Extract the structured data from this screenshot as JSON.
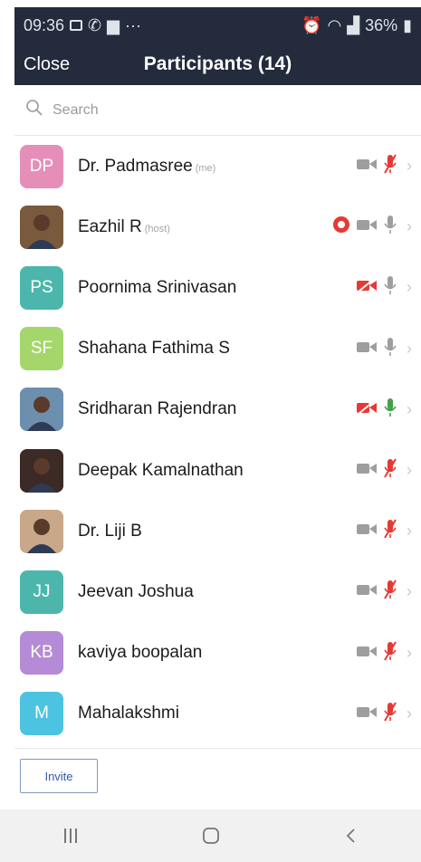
{
  "status_bar": {
    "time": "09:36",
    "battery": "36%",
    "left_icons": [
      "gallery-icon",
      "whatsapp-icon",
      "message-icon",
      "more-dots-icon"
    ],
    "right_icons": [
      "alarm-icon",
      "wifi-icon",
      "signal-icon",
      "battery-icon"
    ]
  },
  "header": {
    "close_label": "Close",
    "title": "Participants (14)"
  },
  "search": {
    "placeholder": "Search"
  },
  "participants": [
    {
      "name": "Dr. Padmasree",
      "tag": "(me)",
      "initials": "DP",
      "avatar_color": "#e58fb8",
      "photo": false,
      "recording": false,
      "video": "off",
      "mic": "muted"
    },
    {
      "name": "Eazhil R",
      "tag": "(host)",
      "initials": "",
      "avatar_color": "#7a5a3c",
      "photo": true,
      "recording": true,
      "video": "off",
      "mic": "on"
    },
    {
      "name": "Poornima Srinivasan",
      "tag": "",
      "initials": "PS",
      "avatar_color": "#4db6ac",
      "photo": false,
      "recording": false,
      "video": "muted",
      "mic": "on"
    },
    {
      "name": "Shahana Fathima S",
      "tag": "",
      "initials": "SF",
      "avatar_color": "#a5d66b",
      "photo": false,
      "recording": false,
      "video": "off",
      "mic": "on"
    },
    {
      "name": "Sridharan Rajendran",
      "tag": "",
      "initials": "",
      "avatar_color": "#6d8fae",
      "photo": true,
      "recording": false,
      "video": "muted",
      "mic": "active"
    },
    {
      "name": "Deepak Kamalnathan",
      "tag": "",
      "initials": "",
      "avatar_color": "#3b2a25",
      "photo": true,
      "recording": false,
      "video": "off",
      "mic": "muted"
    },
    {
      "name": "Dr. Liji B",
      "tag": "",
      "initials": "",
      "avatar_color": "#c9a88a",
      "photo": true,
      "recording": false,
      "video": "off",
      "mic": "muted"
    },
    {
      "name": "Jeevan Joshua",
      "tag": "",
      "initials": "JJ",
      "avatar_color": "#4db6ac",
      "photo": false,
      "recording": false,
      "video": "off",
      "mic": "muted"
    },
    {
      "name": "kaviya boopalan",
      "tag": "",
      "initials": "KB",
      "avatar_color": "#b58ad6",
      "photo": false,
      "recording": false,
      "video": "off",
      "mic": "muted"
    },
    {
      "name": "Mahalakshmi",
      "tag": "",
      "initials": "M",
      "avatar_color": "#4cc3e0",
      "photo": false,
      "recording": false,
      "video": "off",
      "mic": "muted"
    }
  ],
  "footer": {
    "invite_label": "Invite"
  },
  "navbar": {
    "items": [
      "recent-apps-icon",
      "home-icon",
      "back-icon"
    ]
  },
  "colors": {
    "header_bg": "#232b3c",
    "muted_red": "#e53935",
    "icon_gray": "#9e9e9e",
    "active_green": "#43a047",
    "record_red": "#e53935",
    "invite_text": "#2d5aa8"
  }
}
